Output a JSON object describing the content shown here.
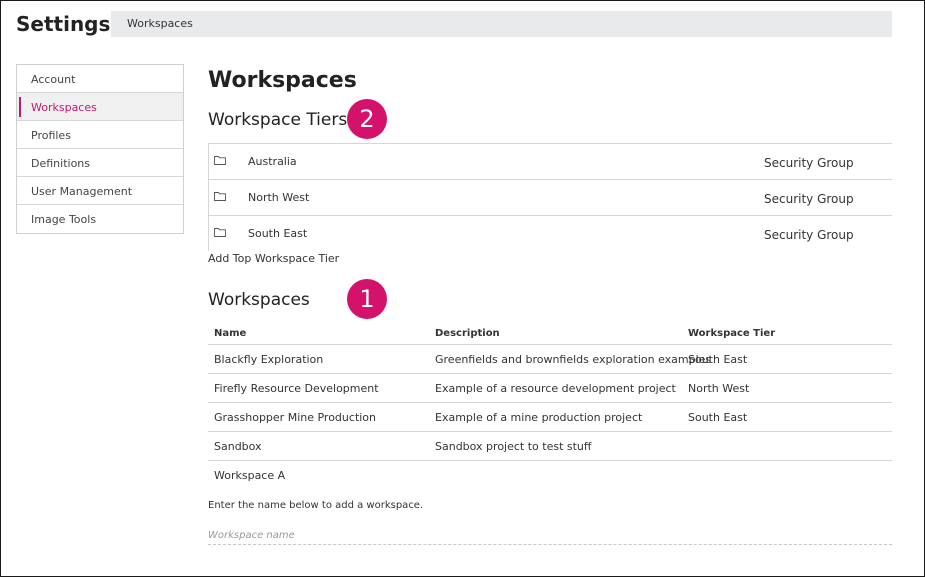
{
  "app": {
    "title": "Settings"
  },
  "breadcrumb": {
    "current": "Workspaces"
  },
  "sidebar": {
    "items": [
      {
        "label": "Account"
      },
      {
        "label": "Workspaces",
        "active": true
      },
      {
        "label": "Profiles"
      },
      {
        "label": "Definitions"
      },
      {
        "label": "User Management"
      },
      {
        "label": "Image Tools"
      }
    ]
  },
  "main": {
    "title": "Workspaces",
    "tiers": {
      "heading": "Workspace Tiers",
      "callout": "2",
      "rows": [
        {
          "name": "Australia",
          "group": "Security Group",
          "icon": "folder-icon"
        },
        {
          "name": "North West",
          "group": "Security Group",
          "icon": "folder-icon"
        },
        {
          "name": "South East",
          "group": "Security Group",
          "icon": "folder-icon"
        }
      ],
      "add_link": "Add Top Workspace Tier"
    },
    "workspaces": {
      "heading": "Workspaces",
      "callout": "1",
      "columns": [
        "Name",
        "Description",
        "Workspace Tier"
      ],
      "rows": [
        {
          "name": "Blackfly Exploration",
          "description": "Greenfields and brownfields exploration examples",
          "tier": "South East"
        },
        {
          "name": "Firefly Resource Development",
          "description": "Example of a resource development project",
          "tier": "North West"
        },
        {
          "name": "Grasshopper Mine Production",
          "description": "Example of a mine production project",
          "tier": "South East"
        },
        {
          "name": "Sandbox",
          "description": "Sandbox project to test stuff",
          "tier": ""
        },
        {
          "name": "Workspace A",
          "description": "",
          "tier": ""
        }
      ],
      "hint": "Enter the name below to add a workspace.",
      "input": {
        "placeholder": "Workspace name",
        "value": ""
      }
    }
  },
  "colors": {
    "accent": "#c4166e",
    "callout": "#d4126b",
    "breadcrumb_bg": "#e9eaec"
  }
}
